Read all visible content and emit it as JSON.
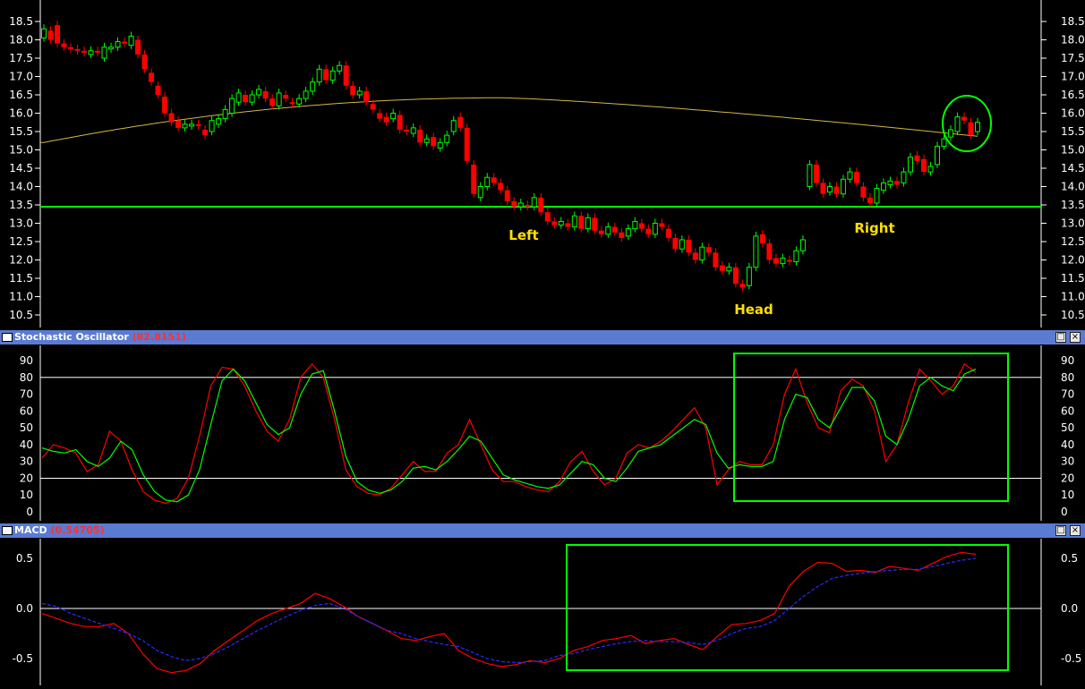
{
  "price_panel": {
    "y_ticks": [
      "18.5",
      "18.0",
      "17.5",
      "17.0",
      "16.5",
      "16.0",
      "15.5",
      "15.0",
      "14.5",
      "14.0",
      "13.5",
      "13.0",
      "12.5",
      "12.0",
      "11.5",
      "11.0",
      "10.5"
    ],
    "labels": {
      "left": "Left",
      "head": "Head",
      "right": "Right"
    },
    "colors": {
      "up": "#00ff00",
      "down": "#ff0000",
      "neckline": "#00ff00",
      "moving_average": "#d4b64a",
      "labels": "#ffe000"
    }
  },
  "stochastic_panel": {
    "title": "Stochastic Oscillator",
    "value": "(82.8151)",
    "y_ticks": [
      "90",
      "80",
      "70",
      "60",
      "50",
      "40",
      "30",
      "20",
      "10",
      "0"
    ]
  },
  "macd_panel": {
    "title": "MACD",
    "value": "(0.54705)",
    "y_ticks": [
      "0.5",
      "0.0",
      "-0.5"
    ]
  },
  "window_buttons": {
    "restore": "□",
    "close": "×"
  },
  "chart_data": [
    {
      "type": "candlestick",
      "neckline": 13.45,
      "ylim": [
        10.2,
        18.8
      ],
      "candles": [
        [
          18.05,
          18.3
        ],
        [
          18.25,
          18.0
        ],
        [
          18.4,
          17.9
        ],
        [
          17.9,
          17.8
        ],
        [
          17.8,
          17.75
        ],
        [
          17.75,
          17.7
        ],
        [
          17.7,
          17.65
        ],
        [
          17.6,
          17.7
        ],
        [
          17.7,
          17.65
        ],
        [
          17.5,
          17.8
        ],
        [
          17.75,
          17.8
        ],
        [
          17.8,
          17.95
        ],
        [
          17.95,
          17.9
        ],
        [
          17.85,
          18.1
        ],
        [
          18.0,
          17.6
        ],
        [
          17.6,
          17.2
        ],
        [
          17.1,
          16.85
        ],
        [
          16.75,
          16.5
        ],
        [
          16.45,
          16.0
        ],
        [
          16.0,
          15.75
        ],
        [
          15.8,
          15.6
        ],
        [
          15.6,
          15.7
        ],
        [
          15.65,
          15.7
        ],
        [
          15.7,
          15.65
        ],
        [
          15.55,
          15.4
        ],
        [
          15.5,
          15.8
        ],
        [
          15.7,
          15.85
        ],
        [
          15.85,
          16.1
        ],
        [
          16.0,
          16.4
        ],
        [
          16.3,
          16.55
        ],
        [
          16.5,
          16.3
        ],
        [
          16.3,
          16.5
        ],
        [
          16.5,
          16.65
        ],
        [
          16.6,
          16.4
        ],
        [
          16.4,
          16.2
        ],
        [
          16.2,
          16.55
        ],
        [
          16.5,
          16.4
        ],
        [
          16.3,
          16.25
        ],
        [
          16.25,
          16.4
        ],
        [
          16.4,
          16.6
        ],
        [
          16.6,
          16.85
        ],
        [
          16.85,
          17.2
        ],
        [
          17.2,
          16.9
        ],
        [
          16.9,
          17.15
        ],
        [
          17.15,
          17.3
        ],
        [
          17.3,
          16.75
        ],
        [
          16.75,
          16.5
        ],
        [
          16.5,
          16.6
        ],
        [
          16.6,
          16.3
        ],
        [
          16.25,
          16.1
        ],
        [
          16.0,
          15.85
        ],
        [
          15.9,
          15.75
        ],
        [
          15.85,
          16.0
        ],
        [
          15.95,
          15.55
        ],
        [
          15.55,
          15.5
        ],
        [
          15.45,
          15.6
        ],
        [
          15.55,
          15.2
        ],
        [
          15.2,
          15.3
        ],
        [
          15.35,
          15.1
        ],
        [
          15.05,
          15.2
        ],
        [
          15.2,
          15.4
        ],
        [
          15.5,
          15.8
        ],
        [
          15.9,
          15.6
        ],
        [
          15.6,
          14.7
        ],
        [
          14.6,
          13.8
        ],
        [
          13.7,
          14.0
        ],
        [
          14.0,
          14.25
        ],
        [
          14.25,
          14.1
        ],
        [
          14.1,
          13.9
        ],
        [
          13.9,
          13.6
        ],
        [
          13.6,
          13.45
        ],
        [
          13.45,
          13.55
        ],
        [
          13.5,
          13.45
        ],
        [
          13.45,
          13.7
        ],
        [
          13.7,
          13.3
        ],
        [
          13.3,
          13.05
        ],
        [
          13.05,
          12.95
        ],
        [
          12.95,
          13.05
        ],
        [
          13.0,
          12.9
        ],
        [
          12.9,
          13.2
        ],
        [
          13.2,
          12.85
        ],
        [
          12.85,
          13.15
        ],
        [
          13.15,
          12.8
        ],
        [
          12.8,
          12.7
        ],
        [
          12.7,
          12.9
        ],
        [
          12.9,
          12.75
        ],
        [
          12.75,
          12.6
        ],
        [
          12.65,
          12.85
        ],
        [
          12.85,
          13.05
        ],
        [
          13.0,
          12.85
        ],
        [
          12.85,
          12.7
        ],
        [
          12.7,
          13.0
        ],
        [
          13.0,
          12.9
        ],
        [
          12.85,
          12.6
        ],
        [
          12.6,
          12.3
        ],
        [
          12.3,
          12.55
        ],
        [
          12.55,
          12.2
        ],
        [
          12.2,
          12.0
        ],
        [
          12.0,
          12.35
        ],
        [
          12.35,
          12.2
        ],
        [
          12.2,
          11.8
        ],
        [
          11.85,
          11.7
        ],
        [
          11.7,
          11.8
        ],
        [
          11.8,
          11.35
        ],
        [
          11.35,
          11.25
        ],
        [
          11.3,
          11.8
        ],
        [
          11.8,
          12.65
        ],
        [
          12.7,
          12.45
        ],
        [
          12.45,
          12.0
        ],
        [
          12.05,
          11.9
        ],
        [
          11.9,
          12.05
        ],
        [
          12.0,
          11.95
        ],
        [
          11.95,
          12.25
        ],
        [
          12.25,
          12.55
        ],
        [
          14.0,
          14.6
        ],
        [
          14.6,
          14.1
        ],
        [
          14.1,
          13.8
        ],
        [
          13.85,
          14.0
        ],
        [
          14.0,
          13.8
        ],
        [
          13.8,
          14.2
        ],
        [
          14.2,
          14.4
        ],
        [
          14.4,
          14.1
        ],
        [
          14.0,
          13.7
        ],
        [
          13.7,
          13.55
        ],
        [
          13.55,
          13.95
        ],
        [
          13.9,
          14.1
        ],
        [
          14.05,
          14.15
        ],
        [
          14.15,
          14.05
        ],
        [
          14.1,
          14.4
        ],
        [
          14.4,
          14.8
        ],
        [
          14.85,
          14.7
        ],
        [
          14.75,
          14.4
        ],
        [
          14.4,
          14.55
        ],
        [
          14.6,
          15.1
        ],
        [
          15.1,
          15.3
        ],
        [
          15.35,
          15.55
        ],
        [
          15.5,
          15.9
        ],
        [
          15.9,
          15.8
        ],
        [
          15.75,
          15.4
        ],
        [
          15.5,
          15.75
        ]
      ],
      "moving_average": {
        "start": 15.2,
        "peak": 16.42,
        "peak_index": 68,
        "end": 15.37
      }
    },
    {
      "type": "line",
      "title": "Stochastic Oscillator",
      "ylim": [
        0,
        96
      ],
      "reference_lines": [
        20,
        80
      ],
      "series": [
        {
          "color": "#ff0000",
          "values": [
            32,
            40,
            38,
            35,
            24,
            28,
            48,
            42,
            25,
            12,
            7,
            5,
            8,
            20,
            45,
            75,
            86,
            85,
            75,
            60,
            48,
            42,
            55,
            80,
            88,
            80,
            55,
            25,
            15,
            11,
            10,
            14,
            22,
            30,
            24,
            24,
            35,
            40,
            55,
            40,
            25,
            18,
            18,
            15,
            13,
            12,
            18,
            30,
            36,
            24,
            16,
            20,
            35,
            40,
            38,
            42,
            48,
            55,
            62,
            50,
            16,
            25,
            30,
            28,
            28,
            40,
            70,
            85,
            65,
            50,
            47,
            72,
            79,
            75,
            60,
            30,
            40,
            65,
            85,
            78,
            70,
            75,
            88,
            83
          ]
        },
        {
          "color": "#00ff00",
          "values": [
            38,
            36,
            35,
            37,
            30,
            27,
            32,
            42,
            37,
            22,
            12,
            7,
            6,
            10,
            25,
            52,
            78,
            85,
            78,
            65,
            52,
            46,
            50,
            70,
            82,
            84,
            60,
            33,
            18,
            13,
            11,
            13,
            18,
            26,
            27,
            25,
            30,
            37,
            45,
            42,
            32,
            22,
            19,
            17,
            15,
            14,
            16,
            23,
            30,
            28,
            20,
            18,
            26,
            36,
            38,
            40,
            45,
            50,
            55,
            52,
            35,
            26,
            28,
            27,
            27,
            30,
            55,
            70,
            68,
            55,
            50,
            62,
            74,
            74,
            66,
            45,
            40,
            55,
            75,
            80,
            75,
            72,
            82,
            85
          ]
        }
      ]
    },
    {
      "type": "line",
      "title": "MACD",
      "ylim": [
        -0.72,
        0.62
      ],
      "reference_lines": [
        0
      ],
      "series": [
        {
          "color": "#ff0000",
          "values": [
            -0.05,
            -0.1,
            -0.15,
            -0.18,
            -0.18,
            -0.15,
            -0.25,
            -0.45,
            -0.6,
            -0.64,
            -0.62,
            -0.55,
            -0.42,
            -0.32,
            -0.22,
            -0.12,
            -0.05,
            0.0,
            0.05,
            0.15,
            0.1,
            0.02,
            -0.08,
            -0.15,
            -0.22,
            -0.3,
            -0.32,
            -0.28,
            -0.25,
            -0.42,
            -0.5,
            -0.55,
            -0.58,
            -0.56,
            -0.52,
            -0.54,
            -0.5,
            -0.42,
            -0.38,
            -0.32,
            -0.3,
            -0.27,
            -0.35,
            -0.32,
            -0.3,
            -0.36,
            -0.41,
            -0.28,
            -0.16,
            -0.15,
            -0.12,
            -0.05,
            0.22,
            0.37,
            0.46,
            0.45,
            0.37,
            0.38,
            0.36,
            0.42,
            0.4,
            0.38,
            0.45,
            0.52,
            0.56,
            0.54
          ]
        },
        {
          "color": "#2a2aff",
          "values": [
            0.05,
            0.02,
            -0.05,
            -0.1,
            -0.15,
            -0.2,
            -0.25,
            -0.32,
            -0.42,
            -0.48,
            -0.52,
            -0.5,
            -0.45,
            -0.38,
            -0.3,
            -0.22,
            -0.15,
            -0.08,
            -0.02,
            0.03,
            0.05,
            0.0,
            -0.08,
            -0.15,
            -0.22,
            -0.25,
            -0.3,
            -0.33,
            -0.36,
            -0.38,
            -0.44,
            -0.5,
            -0.53,
            -0.54,
            -0.53,
            -0.52,
            -0.47,
            -0.45,
            -0.41,
            -0.38,
            -0.35,
            -0.33,
            -0.32,
            -0.33,
            -0.33,
            -0.34,
            -0.36,
            -0.32,
            -0.25,
            -0.2,
            -0.18,
            -0.12,
            0.0,
            0.12,
            0.22,
            0.3,
            0.33,
            0.35,
            0.37,
            0.38,
            0.39,
            0.39,
            0.42,
            0.45,
            0.48,
            0.5
          ]
        }
      ]
    }
  ]
}
